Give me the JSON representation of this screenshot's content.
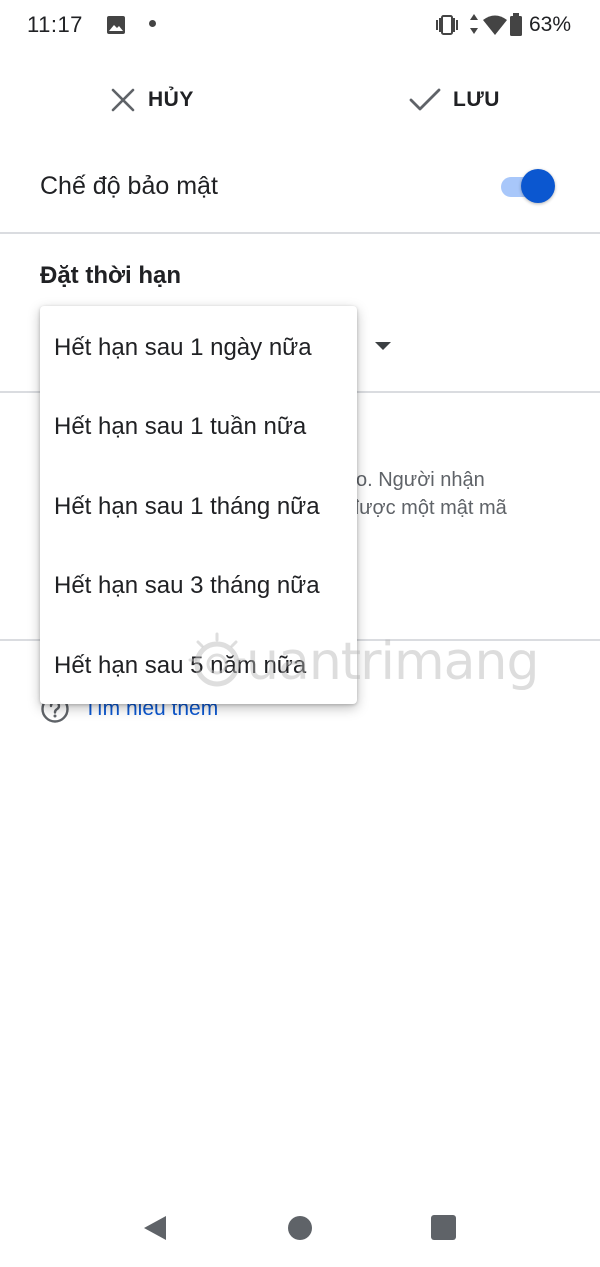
{
  "status_bar": {
    "time": "11:17",
    "battery": "63%",
    "icons": [
      "image-icon",
      "notification-dot",
      "vibrate-icon",
      "mobile-data-icon",
      "wifi-icon",
      "battery-icon"
    ]
  },
  "action_bar": {
    "cancel_label": "HỦY",
    "save_label": "LƯU"
  },
  "confidential": {
    "label": "Chế độ bảo mật",
    "enabled": true
  },
  "expiry": {
    "title": "Đặt thời hạn",
    "options": [
      "Hết hạn sau 1 ngày nữa",
      "Hết hạn sau 1 tuần nữa",
      "Hết hạn sau 1 tháng nữa",
      "Hết hạn sau 3 tháng nữa",
      "Hết hạn sau 5 năm nữa"
    ]
  },
  "passcode_text": {
    "line1": "o. Người nhận",
    "line2": "được một mật mã"
  },
  "learn_more": {
    "label": "Tìm hiểu thêm"
  },
  "watermark": {
    "text": "uantrimang"
  },
  "colors": {
    "accent": "#0b57d0",
    "toggle_track": "#a8c7fa",
    "divider": "#dadce0",
    "secondary_text": "#5f6368"
  }
}
